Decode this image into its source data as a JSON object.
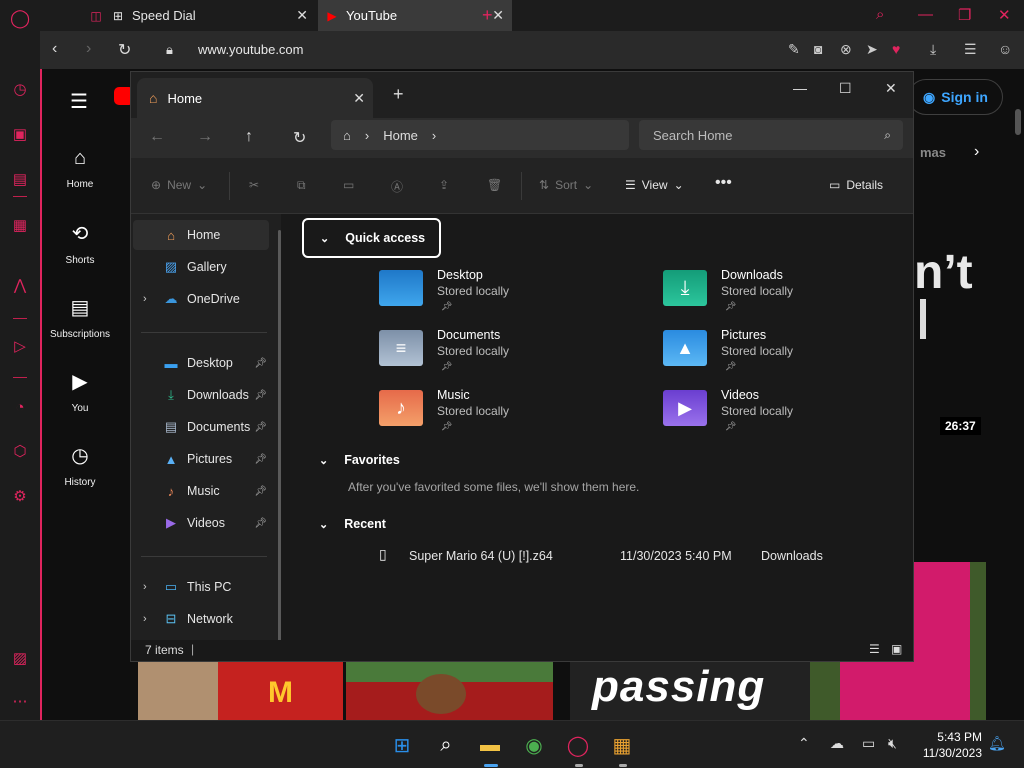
{
  "browser": {
    "tabs": [
      {
        "label": "Speed Dial",
        "active": false
      },
      {
        "label": "YouTube",
        "active": true
      }
    ],
    "url": "www.youtube.com"
  },
  "youtube": {
    "nav": [
      {
        "label": "Home"
      },
      {
        "label": "Shorts"
      },
      {
        "label": "Subscriptions"
      },
      {
        "label": "You"
      },
      {
        "label": "History"
      }
    ],
    "signin_label": "Sign in",
    "chip_partial": "mas",
    "video_duration": "26:37",
    "title_fragment": "n’t",
    "thumb_text": "passing"
  },
  "explorer": {
    "tab_title": "Home",
    "breadcrumb": "Home",
    "search_placeholder": "Search Home",
    "toolbar": {
      "new_label": "New",
      "sort_label": "Sort",
      "view_label": "View",
      "details_label": "Details"
    },
    "sidebar": {
      "top": [
        {
          "label": "Home"
        },
        {
          "label": "Gallery"
        },
        {
          "label": "OneDrive"
        }
      ],
      "pinned": [
        {
          "label": "Desktop"
        },
        {
          "label": "Downloads"
        },
        {
          "label": "Documents"
        },
        {
          "label": "Pictures"
        },
        {
          "label": "Music"
        },
        {
          "label": "Videos"
        }
      ],
      "bottom": [
        {
          "label": "This PC"
        },
        {
          "label": "Network"
        }
      ]
    },
    "quick_access": {
      "header": "Quick access",
      "folders": [
        {
          "name": "Desktop",
          "status": "Stored locally",
          "color": "#2f8fdc"
        },
        {
          "name": "Downloads",
          "status": "Stored locally",
          "color": "#1fae8a"
        },
        {
          "name": "Documents",
          "status": "Stored locally",
          "color": "#8aa0b8"
        },
        {
          "name": "Pictures",
          "status": "Stored locally",
          "color": "#3d9be8"
        },
        {
          "name": "Music",
          "status": "Stored locally",
          "color": "#ec7f58"
        },
        {
          "name": "Videos",
          "status": "Stored locally",
          "color": "#7b52d6"
        }
      ]
    },
    "favorites": {
      "header": "Favorites",
      "empty_text": "After you've favorited some files, we'll show them here."
    },
    "recent": {
      "header": "Recent",
      "items": [
        {
          "name": "Super Mario 64 (U) [!].z64",
          "date": "11/30/2023 5:40 PM",
          "location": "Downloads"
        }
      ]
    },
    "status": {
      "items_count": "7 items"
    }
  },
  "taskbar": {
    "time": "5:43 PM",
    "date": "11/30/2023"
  },
  "colors": {
    "opera_accent": "#e0245e",
    "youtube_red": "#ff0000",
    "link_blue": "#3ea6ff"
  }
}
